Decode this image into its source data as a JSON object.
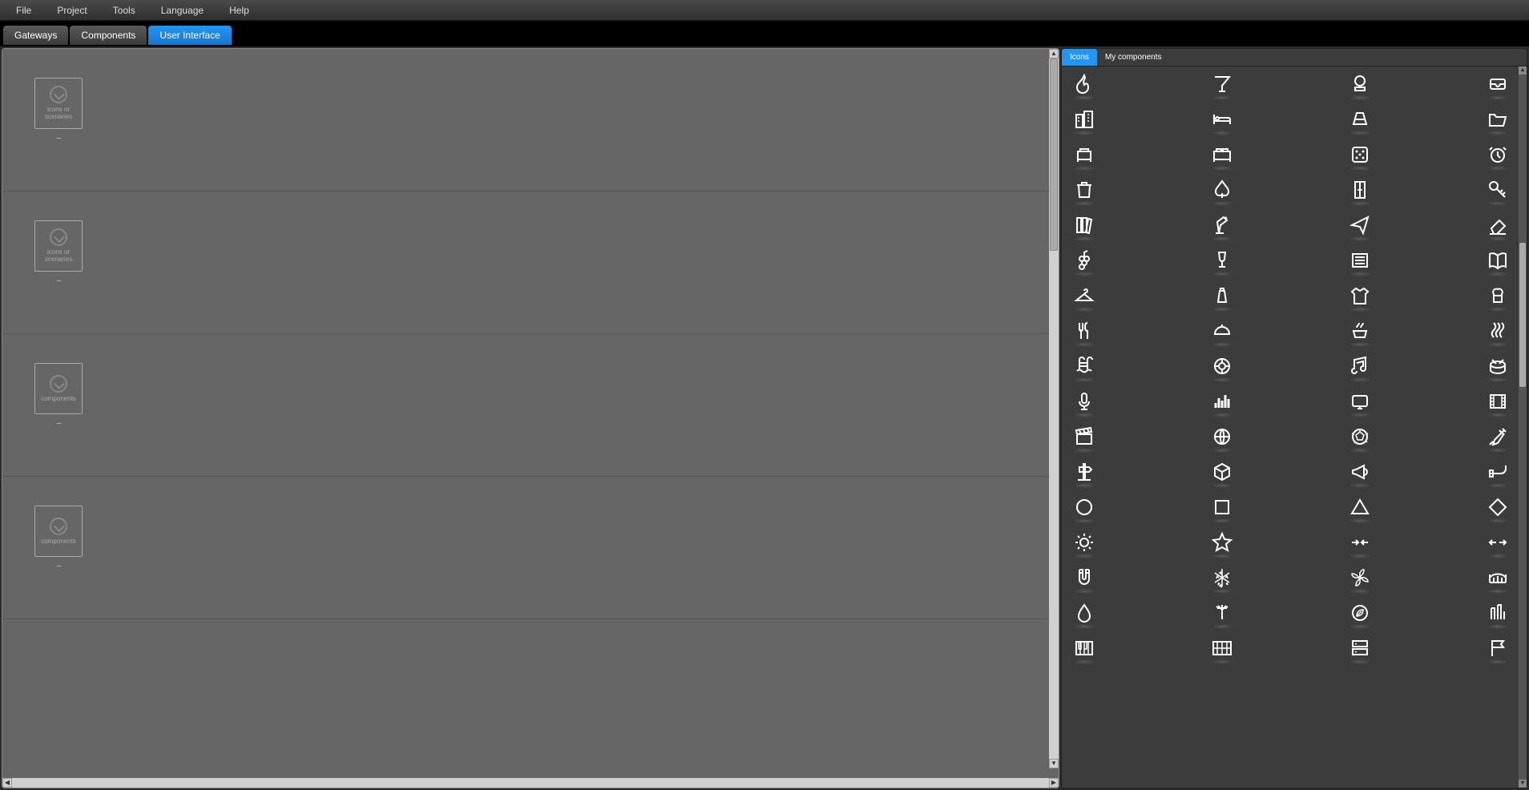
{
  "menu": {
    "items": [
      "File",
      "Project",
      "Tools",
      "Language",
      "Help"
    ]
  },
  "tabs": {
    "items": [
      "Gateways",
      "Components",
      "User Interface"
    ],
    "active": 2
  },
  "canvas": {
    "rows": [
      {
        "label": "icons or scenaries",
        "sub": "–"
      },
      {
        "label": "icons or scenaries",
        "sub": "–"
      },
      {
        "label": "components",
        "sub": "–"
      },
      {
        "label": "components",
        "sub": "–"
      }
    ]
  },
  "side": {
    "tabs": {
      "items": [
        "Icons",
        "My components"
      ],
      "active": 0
    },
    "icons": [
      "fire",
      "cocktail",
      "ac-unit",
      "inbox",
      "buildings",
      "bed",
      "perspective",
      "folder-open",
      "bed-single",
      "bed-double",
      "dice",
      "alarm",
      "trash",
      "spade",
      "door",
      "key",
      "books",
      "desk-lamp",
      "send",
      "eraser",
      "grapes",
      "wine",
      "list",
      "book-open",
      "hanger",
      "salt",
      "tshirt",
      "chef",
      "utensils",
      "cloche",
      "steamer",
      "heat",
      "pool",
      "lifebuoy",
      "music",
      "drum",
      "mic",
      "equalizer",
      "tv",
      "film",
      "clapper",
      "globe",
      "soccer",
      "syringe",
      "signpost",
      "cube",
      "megaphone",
      "pipe",
      "circle",
      "square",
      "triangle",
      "diamond",
      "sun",
      "star",
      "compress",
      "expand",
      "magnet",
      "snowflake",
      "fan",
      "bridge",
      "droplet",
      "sprinkler",
      "leaf-circle",
      "bars",
      "piano",
      "keyboard",
      "server",
      "flag"
    ]
  }
}
